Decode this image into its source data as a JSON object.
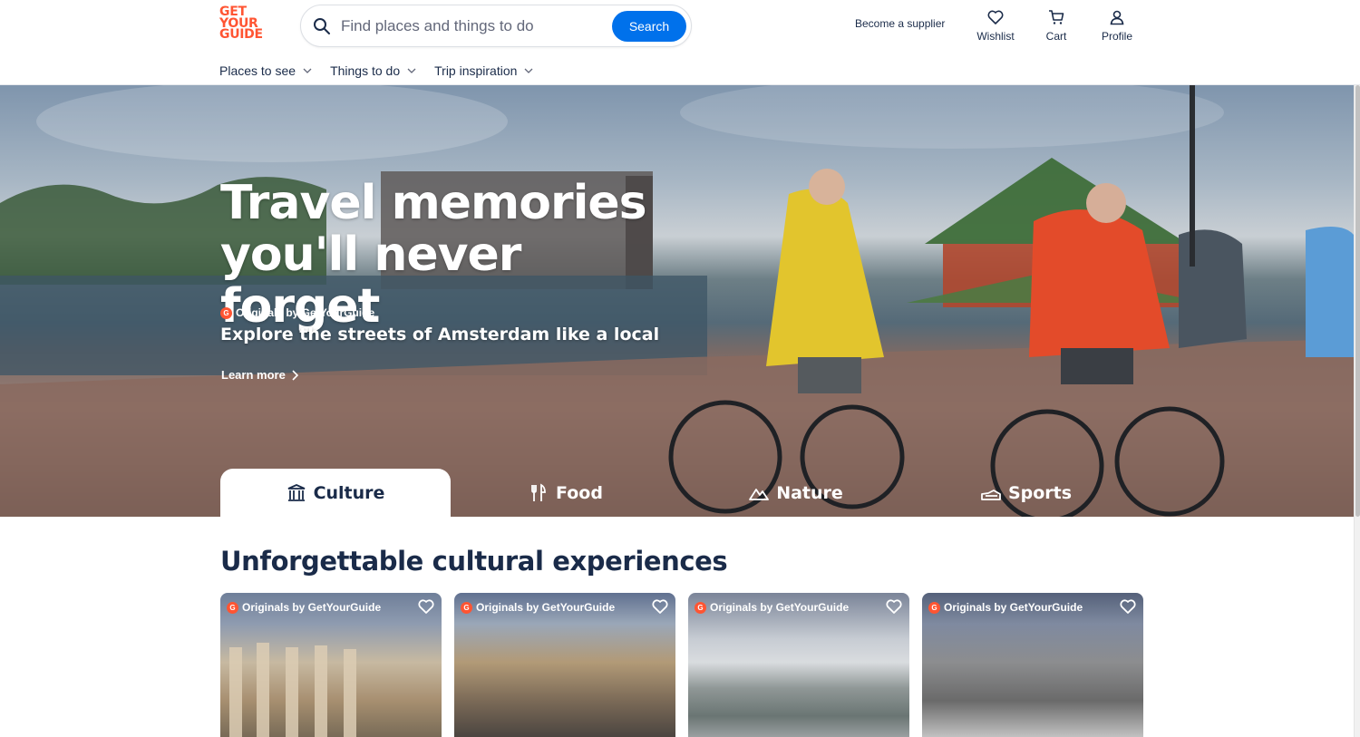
{
  "header": {
    "logo_lines": [
      "GET",
      "YOUR",
      "GUIDE"
    ],
    "search": {
      "placeholder": "Find places and things to do",
      "button_label": "Search"
    },
    "supplier_label": "Become a supplier",
    "wishlist_label": "Wishlist",
    "cart_label": "Cart",
    "profile_label": "Profile"
  },
  "subnav": {
    "items": [
      {
        "label": "Places to see"
      },
      {
        "label": "Things to do"
      },
      {
        "label": "Trip inspiration"
      }
    ]
  },
  "hero": {
    "title": "Travel memories you'll never forget",
    "badge": "Originals by GetYourGuide",
    "subtitle": "Explore the streets of Amsterdam like a local",
    "link_label": "Learn more"
  },
  "tabs": [
    {
      "label": "Culture",
      "icon": "museum-icon",
      "active": true
    },
    {
      "label": "Food",
      "icon": "cutlery-icon",
      "active": false
    },
    {
      "label": "Nature",
      "icon": "mountain-icon",
      "active": false
    },
    {
      "label": "Sports",
      "icon": "sports-icon",
      "active": false
    }
  ],
  "section": {
    "title": "Unforgettable cultural experiences",
    "cards": [
      {
        "badge": "Originals by GetYourGuide"
      },
      {
        "badge": "Originals by GetYourGuide"
      },
      {
        "badge": "Originals by GetYourGuide"
      },
      {
        "badge": "Originals by GetYourGuide"
      }
    ]
  },
  "colors": {
    "brand": "#ff5533",
    "primary_button": "#0071eb",
    "text": "#1a2b49"
  }
}
